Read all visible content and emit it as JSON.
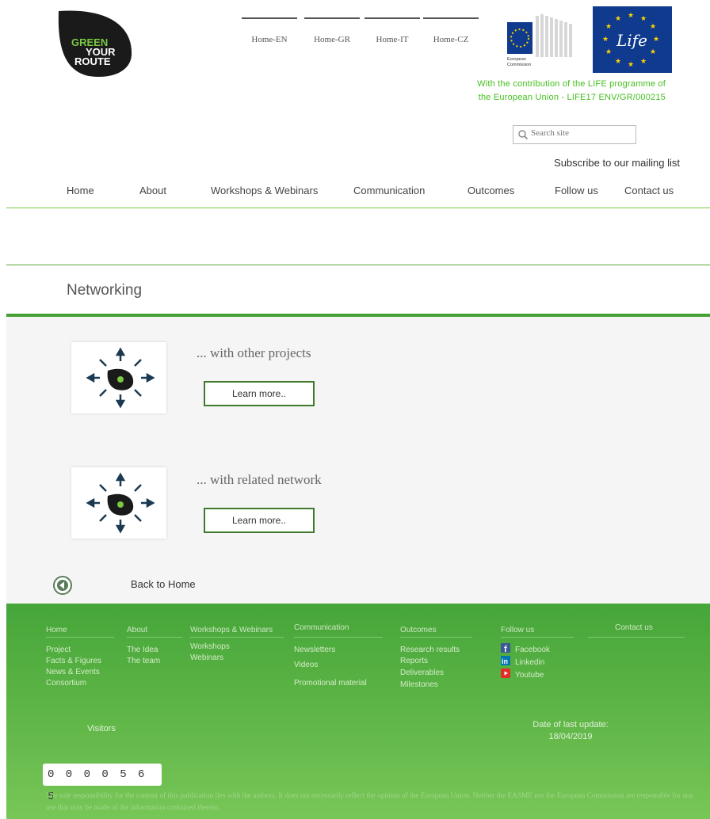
{
  "logo": {
    "lines": [
      "GREEN",
      "YOUR",
      "ROUTE"
    ]
  },
  "languages": [
    "Home-EN",
    "Home-GR",
    "Home-IT",
    "Home-CZ"
  ],
  "ec_logo": {
    "text": [
      "European",
      "Commission"
    ]
  },
  "life_logo": {
    "text": "Life"
  },
  "life_note": [
    "With the contribution of the LIFE programme of",
    "the European Union - LIFE17 ENV/GR/000215"
  ],
  "search": {
    "placeholder": "Search site"
  },
  "mailing_link": "Subscribe to our mailing list",
  "nav": [
    "Home",
    "About",
    "Workshops & Webinars",
    "Communication",
    "Outcomes",
    "Follow us",
    "Contact us"
  ],
  "page_title": "Networking",
  "cards": [
    {
      "title": "... with other projects",
      "button": "Learn more.."
    },
    {
      "title": "... with related network",
      "button": "Learn more.."
    }
  ],
  "back_to_home": "Back to Home",
  "footer": {
    "columns": [
      {
        "heading": "Home",
        "links": [
          "Project",
          "Facts & Figures",
          "News & Events",
          "Consortium"
        ]
      },
      {
        "heading": "About",
        "links": [
          "The Idea",
          "The team"
        ]
      },
      {
        "heading": "Workshops & Webinars",
        "links": [
          "Workshops",
          "Webinars"
        ]
      },
      {
        "heading": "Communication",
        "links": [
          "Newsletters",
          "Videos",
          "Promotional material"
        ]
      },
      {
        "heading": "Outcomes",
        "links": [
          "Research results",
          "Reports",
          "Deliverables",
          "Milestones"
        ]
      },
      {
        "heading": "Follow us",
        "links": [
          "Facebook",
          "Linkedin",
          "Youtube"
        ]
      },
      {
        "heading": "Contact us",
        "links": []
      }
    ],
    "visitors_label": "Visitors",
    "counter": "0 0 0 0 5 6 5",
    "last_update_label": "Date of last update:",
    "last_update_date": "18/04/2019",
    "disclaimer": "The sole responsibility for the content of this publication lies with the authors. It does not necessarily reflect the opinion of the European Union. Neither the EASME nor the European Commission are responsible for any use that may be made of the information contained therein."
  },
  "colors": {
    "brand_green": "#47a035",
    "life_green": "#44c01e",
    "button_border": "#3f7a2c",
    "footer_green": "#59b243",
    "eu_blue": "#0f3a8e"
  }
}
